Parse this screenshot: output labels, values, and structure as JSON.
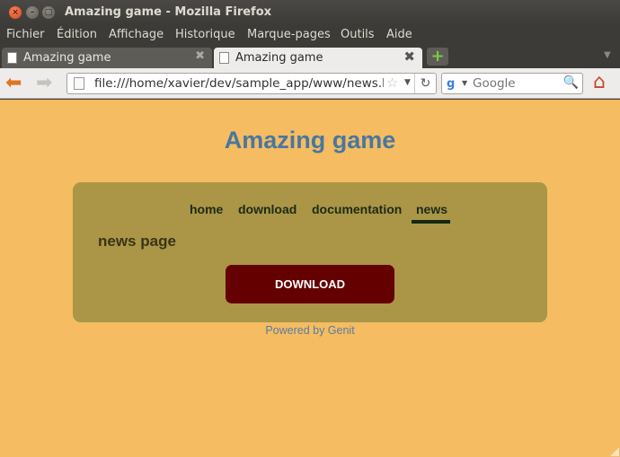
{
  "window": {
    "title": "Amazing game - Mozilla Firefox",
    "close_glyph": "×",
    "min_glyph": "–",
    "max_glyph": "□"
  },
  "menu": [
    "Fichier",
    "Édition",
    "Affichage",
    "Historique",
    "Marque-pages",
    "Outils",
    "Aide"
  ],
  "tabs": [
    {
      "title": "Amazing game",
      "active": false
    },
    {
      "title": "Amazing game",
      "active": true
    }
  ],
  "tab_close_glyph": "✖",
  "new_tab_glyph": "+",
  "tab_list_glyph": "▼",
  "navbar": {
    "back_glyph": "⬅",
    "forward_glyph": "➡",
    "url": "file:///home/xavier/dev/sample_app/www/news.ht",
    "star_glyph": "☆",
    "dropdown_glyph": "▼",
    "reload_glyph": "↻",
    "search_engine_glyph": "g",
    "search_placeholder": "Google",
    "search_glyph": "🔍",
    "home_glyph": "⌂"
  },
  "page": {
    "title": "Amazing game",
    "nav": [
      "home",
      "download",
      "documentation",
      "news"
    ],
    "active_nav": "news",
    "heading": "news page",
    "download_label": "DOWNLOAD",
    "footer": "Powered by Genit"
  },
  "colors": {
    "page_background": "#f5bc62",
    "panel": "#aa9646",
    "title": "#4877a0",
    "download_button": "#650000",
    "active_underline": "#132a12"
  }
}
